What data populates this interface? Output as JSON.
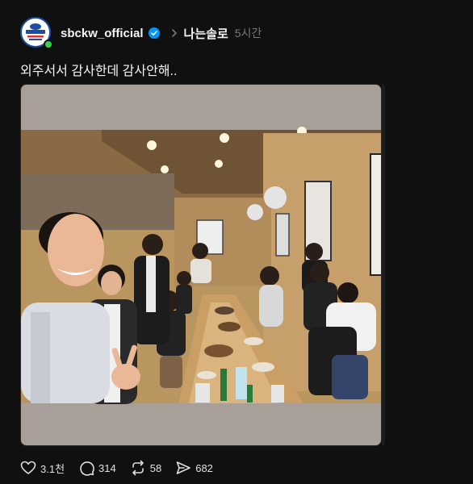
{
  "post": {
    "username": "sbckw_official",
    "verified": true,
    "topic": "나는솔로",
    "time": "5시간",
    "caption": "외주서서 감사한데 감사안해..",
    "avatar_icon": "sbc-logo-icon",
    "online_status_color": "#3ad24a",
    "photo": {
      "description_icon": "group-photo-image"
    }
  },
  "actions": {
    "like_count": "3.1천",
    "reply_count": "314",
    "repost_count": "58",
    "share_count": "682"
  },
  "colors": {
    "background": "#101010",
    "text": "#f3f5f7",
    "muted": "#777777",
    "verified": "#0095f6"
  }
}
